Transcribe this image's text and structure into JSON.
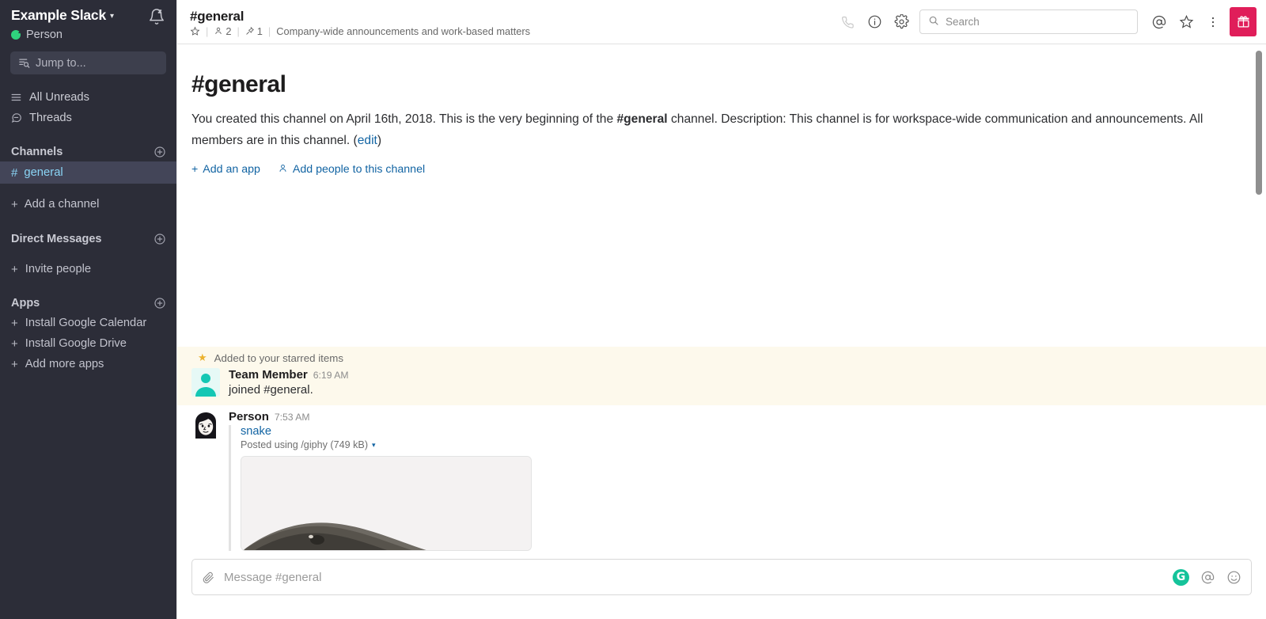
{
  "sidebar": {
    "workspace_name": "Example Slack",
    "workspace_chevron": "▾",
    "notifications_icon": "bell-snooze-icon",
    "user_name": "Person",
    "presence": "away-snooze",
    "jump_to": "Jump to...",
    "nav": [
      {
        "label": "All Unreads",
        "icon": "unreads-icon"
      },
      {
        "label": "Threads",
        "icon": "threads-icon"
      }
    ],
    "channels_section": {
      "title": "Channels",
      "add_icon": "plus-circle-icon",
      "items": [
        {
          "label": "general",
          "prefix": "#",
          "active": true
        }
      ],
      "add_label": "Add a channel"
    },
    "dms_section": {
      "title": "Direct Messages",
      "add_icon": "plus-circle-icon",
      "invite_label": "Invite people"
    },
    "apps_section": {
      "title": "Apps",
      "add_icon": "plus-circle-icon",
      "items": [
        {
          "label": "Install Google Calendar"
        },
        {
          "label": "Install Google Drive"
        },
        {
          "label": "Add more apps"
        }
      ]
    }
  },
  "topbar": {
    "channel_title": "#general",
    "star_icon": "star-outline-icon",
    "members_icon": "person-icon",
    "members_count": "2",
    "pins_icon": "pin-icon",
    "pins_count": "1",
    "topic": "Company-wide announcements and work-based matters",
    "call_icon": "phone-icon",
    "info_icon": "info-circle-icon",
    "settings_icon": "gear-icon",
    "search_placeholder": "Search",
    "search_value": "",
    "mention_icon": "at-icon",
    "starred_icon": "star-outline-icon",
    "more_icon": "kebab-menu-icon",
    "gift_icon": "gift-icon",
    "gift_color": "#e01e5a"
  },
  "intro": {
    "heading": "#general",
    "text_1": "You created this channel on April 16th, 2018. This is the very beginning of the ",
    "bold_1": "#general",
    "text_2": " channel. Description: This channel is for workspace-wide communication and announcements. All members are in this channel. (",
    "edit_link": "edit",
    "text_3": ")",
    "add_app": "Add an app",
    "add_people": "Add people to this channel"
  },
  "messages": {
    "starred_notice": "Added to your starred items",
    "items": [
      {
        "author": "Team Member",
        "time": "6:19 AM",
        "text": "joined #general.",
        "avatar": "default-person-avatar",
        "starred": true
      },
      {
        "author": "Person",
        "time": "7:53 AM",
        "avatar": "cartoon-face-avatar",
        "starred": false,
        "attachment": {
          "title": "snake",
          "subtitle": "Posted using /giphy (749 kB)",
          "caret": "▾",
          "image": "snake-gif-thumbnail"
        }
      }
    ]
  },
  "composer": {
    "attach_icon": "paperclip-icon",
    "placeholder": "Message #general",
    "value": "",
    "grammarly_label": "G",
    "mention_icon": "at-icon",
    "emoji_icon": "smiley-icon"
  },
  "colors": {
    "sidebar_bg": "#2c2d38",
    "sidebar_active": "#434558",
    "active_channel_text": "#8ad4f5",
    "link": "#1264a3",
    "starred_bg": "#fdf9ec",
    "accent_pink": "#e01e5a",
    "grammarly_green": "#15c39a"
  }
}
